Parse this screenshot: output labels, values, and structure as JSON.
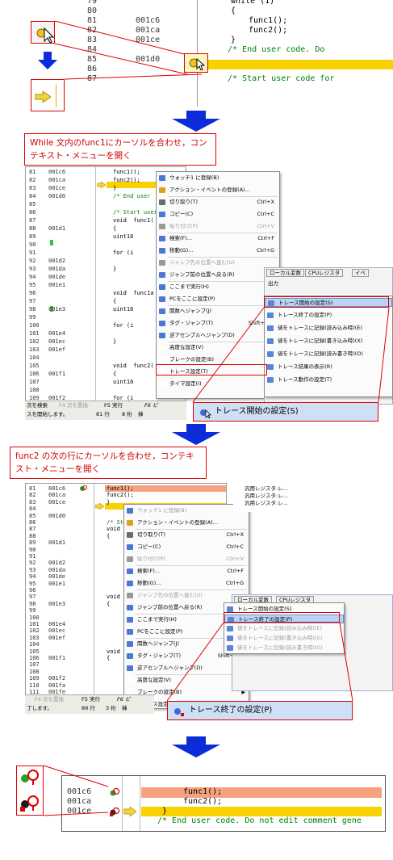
{
  "top_code": {
    "lines": [
      {
        "no": "79",
        "addr": "",
        "code": "while (1)"
      },
      {
        "no": "80",
        "addr": "",
        "code": "{"
      },
      {
        "no": "81",
        "addr": "001c6",
        "code": "func1();"
      },
      {
        "no": "82",
        "addr": "001ca",
        "code": "func2();"
      },
      {
        "no": "83",
        "addr": "001ce",
        "code": "}"
      },
      {
        "no": "84",
        "addr": "",
        "code": "/* End user code. Do"
      },
      {
        "no": "85",
        "addr": "001d0",
        "code": ""
      },
      {
        "no": "86",
        "addr": "",
        "code": ""
      },
      {
        "no": "87",
        "addr": "",
        "code": "/* Start user code for"
      }
    ]
  },
  "callout1": "While 文内のfunc1にカーソルを合わせ，コンテキスト・メニューを開く",
  "callout2": "func2 の次の行にカーソルを合わせ，コンテキスト・メニューを開く",
  "shot1": {
    "lines": [
      {
        "no": "81",
        "addr": "001c6",
        "code": "func1();"
      },
      {
        "no": "82",
        "addr": "001ca",
        "code": "func2();"
      },
      {
        "no": "83",
        "addr": "001ce",
        "code": "}"
      },
      {
        "no": "84",
        "addr": "001d0",
        "code": "/* End user"
      },
      {
        "no": "85",
        "addr": "",
        "code": ""
      },
      {
        "no": "86",
        "addr": "",
        "code": "/* Start user c"
      },
      {
        "no": "87",
        "addr": "",
        "code": "void  func1("
      },
      {
        "no": "88",
        "addr": "001d1",
        "code": "{"
      },
      {
        "no": "89",
        "addr": "",
        "code": "uint16"
      },
      {
        "no": "90",
        "addr": "",
        "code": ""
      },
      {
        "no": "91",
        "addr": "",
        "code": "for (i"
      },
      {
        "no": "92",
        "addr": "001d2",
        "code": ""
      },
      {
        "no": "93",
        "addr": "001da",
        "code": "}"
      },
      {
        "no": "94",
        "addr": "001de",
        "code": ""
      },
      {
        "no": "95",
        "addr": "001e1",
        "code": ""
      },
      {
        "no": "96",
        "addr": "",
        "code": "void  func1a"
      },
      {
        "no": "97",
        "addr": "",
        "code": "{"
      },
      {
        "no": "98",
        "addr": "001e3",
        "code": "uint16"
      },
      {
        "no": "99",
        "addr": "",
        "code": ""
      },
      {
        "no": "100",
        "addr": "",
        "code": "for (i"
      },
      {
        "no": "101",
        "addr": "001e4",
        "code": ""
      },
      {
        "no": "102",
        "addr": "001ec",
        "code": "}"
      },
      {
        "no": "103",
        "addr": "001ef",
        "code": ""
      },
      {
        "no": "104",
        "addr": "",
        "code": ""
      },
      {
        "no": "105",
        "addr": "",
        "code": "void  func2("
      },
      {
        "no": "106",
        "addr": "001f1",
        "code": "{"
      },
      {
        "no": "107",
        "addr": "",
        "code": "uint16"
      },
      {
        "no": "108",
        "addr": "",
        "code": ""
      },
      {
        "no": "109",
        "addr": "001f2",
        "code": "for (i"
      },
      {
        "no": "110",
        "addr": "001fa",
        "code": ""
      }
    ],
    "menu": [
      {
        "label": "ウォッチ1 に登録(B)",
        "sc": "",
        "dis": false,
        "arrow": false
      },
      {
        "label": "アクション・イベントの登録(A)...",
        "sc": "",
        "dis": false,
        "arrow": false
      },
      {
        "label": "切り取り(T)",
        "sc": "Ctrl+X",
        "dis": false,
        "arrow": false
      },
      {
        "label": "コピー(C)",
        "sc": "Ctrl+C",
        "dis": false,
        "arrow": false
      },
      {
        "label": "貼り付け(P)",
        "sc": "Ctrl+V",
        "dis": true,
        "arrow": false
      },
      {
        "label": "検索(F)...",
        "sc": "Ctrl+F",
        "dis": false,
        "arrow": false
      },
      {
        "label": "移動(G)...",
        "sc": "Ctrl+G",
        "dis": false,
        "arrow": false
      },
      {
        "label": "ジャンプ先の位置へ進む(U)",
        "sc": "",
        "dis": true,
        "arrow": false
      },
      {
        "label": "ジャンプ前の位置へ戻る(R)",
        "sc": "",
        "dis": false,
        "arrow": false
      },
      {
        "label": "ここまで実行(H)",
        "sc": "",
        "dis": false,
        "arrow": false
      },
      {
        "label": "PCをここに設定(P)",
        "sc": "",
        "dis": false,
        "arrow": false
      },
      {
        "label": "関数へジャンプ(J)",
        "sc": "F12",
        "dis": false,
        "arrow": false
      },
      {
        "label": "タグ・ジャンプ(T)",
        "sc": "Shift+F12",
        "dis": false,
        "arrow": false
      },
      {
        "label": "逆アセンブルへジャンプ(D)",
        "sc": "",
        "dis": false,
        "arrow": false
      },
      {
        "label": "高度な設定(V)",
        "sc": "",
        "dis": false,
        "arrow": true
      },
      {
        "label": "ブレークの設定(B)",
        "sc": "",
        "dis": false,
        "arrow": true
      },
      {
        "label": "トレース設定(T)",
        "sc": "",
        "dis": false,
        "arrow": true
      },
      {
        "label": "タイマ設定(I)",
        "sc": "",
        "dis": false,
        "arrow": true
      }
    ],
    "submenu": [
      {
        "label": "トレース開始の設定(S)",
        "dis": false
      },
      {
        "label": "トレース終了の設定(P)",
        "dis": false
      },
      {
        "label": "値をトレースに記録(読み込み時)(E)",
        "dis": false
      },
      {
        "label": "値をトレースに記録(書き込み時)(X)",
        "dis": false
      },
      {
        "label": "値をトレースに記録(読み書き時)(O)",
        "dis": false
      },
      {
        "label": "トレース結果の表示(R)",
        "dis": false
      },
      {
        "label": "トレース動作の設定(T)",
        "dis": false
      }
    ],
    "tabs": [
      "ローカル変数",
      "CPUレジスタ",
      "イベ"
    ],
    "output_label": "出力",
    "status_left": "次を検索",
    "status_f4": "F4 次を置換",
    "status_f5": "F5 実行",
    "status_f6": "F6 ピ",
    "status_msg": "スを開始します。",
    "status_row": "81 行",
    "status_col": "8 桁",
    "status_ins": "挿",
    "popup": "トレース開始の設定(S)"
  },
  "shot2": {
    "lines": [
      {
        "no": "81",
        "addr": "001c6",
        "code": "func1();"
      },
      {
        "no": "82",
        "addr": "001ca",
        "code": "func2();"
      },
      {
        "no": "83",
        "addr": "001ce",
        "code": "}"
      },
      {
        "no": "84",
        "addr": "",
        "code": ""
      },
      {
        "no": "85",
        "addr": "001d0",
        "code": ""
      },
      {
        "no": "86",
        "addr": "",
        "code": "/* Start"
      },
      {
        "no": "87",
        "addr": "",
        "code": "void"
      },
      {
        "no": "88",
        "addr": "",
        "code": "{"
      },
      {
        "no": "89",
        "addr": "001d1",
        "code": ""
      },
      {
        "no": "90",
        "addr": "",
        "code": ""
      },
      {
        "no": "91",
        "addr": "",
        "code": ""
      },
      {
        "no": "92",
        "addr": "001d2",
        "code": ""
      },
      {
        "no": "93",
        "addr": "001da",
        "code": ""
      },
      {
        "no": "94",
        "addr": "001de",
        "code": ""
      },
      {
        "no": "95",
        "addr": "001e1",
        "code": ""
      },
      {
        "no": "96",
        "addr": "",
        "code": ""
      },
      {
        "no": "97",
        "addr": "",
        "code": "void"
      },
      {
        "no": "98",
        "addr": "001e3",
        "code": "{"
      },
      {
        "no": "99",
        "addr": "",
        "code": ""
      },
      {
        "no": "100",
        "addr": "",
        "code": ""
      },
      {
        "no": "101",
        "addr": "001e4",
        "code": ""
      },
      {
        "no": "102",
        "addr": "001ec",
        "code": ""
      },
      {
        "no": "103",
        "addr": "001ef",
        "code": ""
      },
      {
        "no": "104",
        "addr": "",
        "code": ""
      },
      {
        "no": "105",
        "addr": "",
        "code": "void"
      },
      {
        "no": "106",
        "addr": "001f1",
        "code": "{"
      },
      {
        "no": "107",
        "addr": "",
        "code": ""
      },
      {
        "no": "108",
        "addr": "",
        "code": ""
      },
      {
        "no": "109",
        "addr": "001f2",
        "code": ""
      },
      {
        "no": "110",
        "addr": "001fa",
        "code": ""
      },
      {
        "no": "111",
        "addr": "001fe",
        "code": ""
      }
    ],
    "menu": [
      {
        "label": "ウォッチ1 に登録(B)",
        "sc": "",
        "dis": true,
        "arrow": false
      },
      {
        "label": "アクション・イベントの登録(A)...",
        "sc": "",
        "dis": false,
        "arrow": false
      },
      {
        "label": "切り取り(T)",
        "sc": "Ctrl+X",
        "dis": false,
        "arrow": false
      },
      {
        "label": "コピー(C)",
        "sc": "Ctrl+C",
        "dis": false,
        "arrow": false
      },
      {
        "label": "貼り付け(P)",
        "sc": "Ctrl+V",
        "dis": true,
        "arrow": false
      },
      {
        "label": "検索(F)...",
        "sc": "Ctrl+F",
        "dis": false,
        "arrow": false
      },
      {
        "label": "移動(G)...",
        "sc": "Ctrl+G",
        "dis": false,
        "arrow": false
      },
      {
        "label": "ジャンプ先の位置へ進む(U)",
        "sc": "",
        "dis": true,
        "arrow": false
      },
      {
        "label": "ジャンプ前の位置へ戻る(R)",
        "sc": "",
        "dis": false,
        "arrow": false
      },
      {
        "label": "ここまで実行(H)",
        "sc": "",
        "dis": false,
        "arrow": false
      },
      {
        "label": "PCをここに設定(P)",
        "sc": "",
        "dis": false,
        "arrow": false
      },
      {
        "label": "関数へジャンプ(J)",
        "sc": "F12",
        "dis": false,
        "arrow": false
      },
      {
        "label": "タグ・ジャンプ(T)",
        "sc": "Shift+F12",
        "dis": false,
        "arrow": false
      },
      {
        "label": "逆アセンブルへジャンプ(D)",
        "sc": "",
        "dis": false,
        "arrow": false
      },
      {
        "label": "高度な設定(V)",
        "sc": "",
        "dis": false,
        "arrow": true
      },
      {
        "label": "ブレークの設定(B)",
        "sc": "",
        "dis": false,
        "arrow": true
      },
      {
        "label": "トレース設定",
        "sc": "",
        "dis": false,
        "arrow": true
      }
    ],
    "submenu": [
      {
        "label": "トレース開始の設定(S)",
        "dis": false
      },
      {
        "label": "トレース終了の設定(P)",
        "dis": false
      },
      {
        "label": "値をトレースに記録(読み込み時)(E)",
        "dis": true
      },
      {
        "label": "値をトレースに記録(書き込み時)(X)",
        "dis": true
      },
      {
        "label": "値をトレースに記録(読み書き時)(O)",
        "dis": true
      }
    ],
    "tree": [
      "汎用レジスタ:レ...",
      "汎用レジスタ:レ...",
      "汎用レジスタ:レ..."
    ],
    "tabs": [
      "ローカル変数",
      "CPUレジスタ"
    ],
    "output_label": "出力",
    "status_f4": "F4 次を置換",
    "status_f5": "F5 実行",
    "status_f6": "F6 ピ",
    "status_msg": "了します。",
    "status_row": "89 行",
    "status_col": "3 桁",
    "status_ins": "挿",
    "popup": "トレース終了の設定(P)"
  },
  "bottom_code": {
    "lines": [
      {
        "addr": "001c6",
        "code": "func1();"
      },
      {
        "addr": "001ca",
        "code": "func2();"
      },
      {
        "addr": "001ce",
        "code": "}"
      },
      {
        "addr": "",
        "code": "/* End user code. Do not edit comment gene"
      }
    ]
  }
}
